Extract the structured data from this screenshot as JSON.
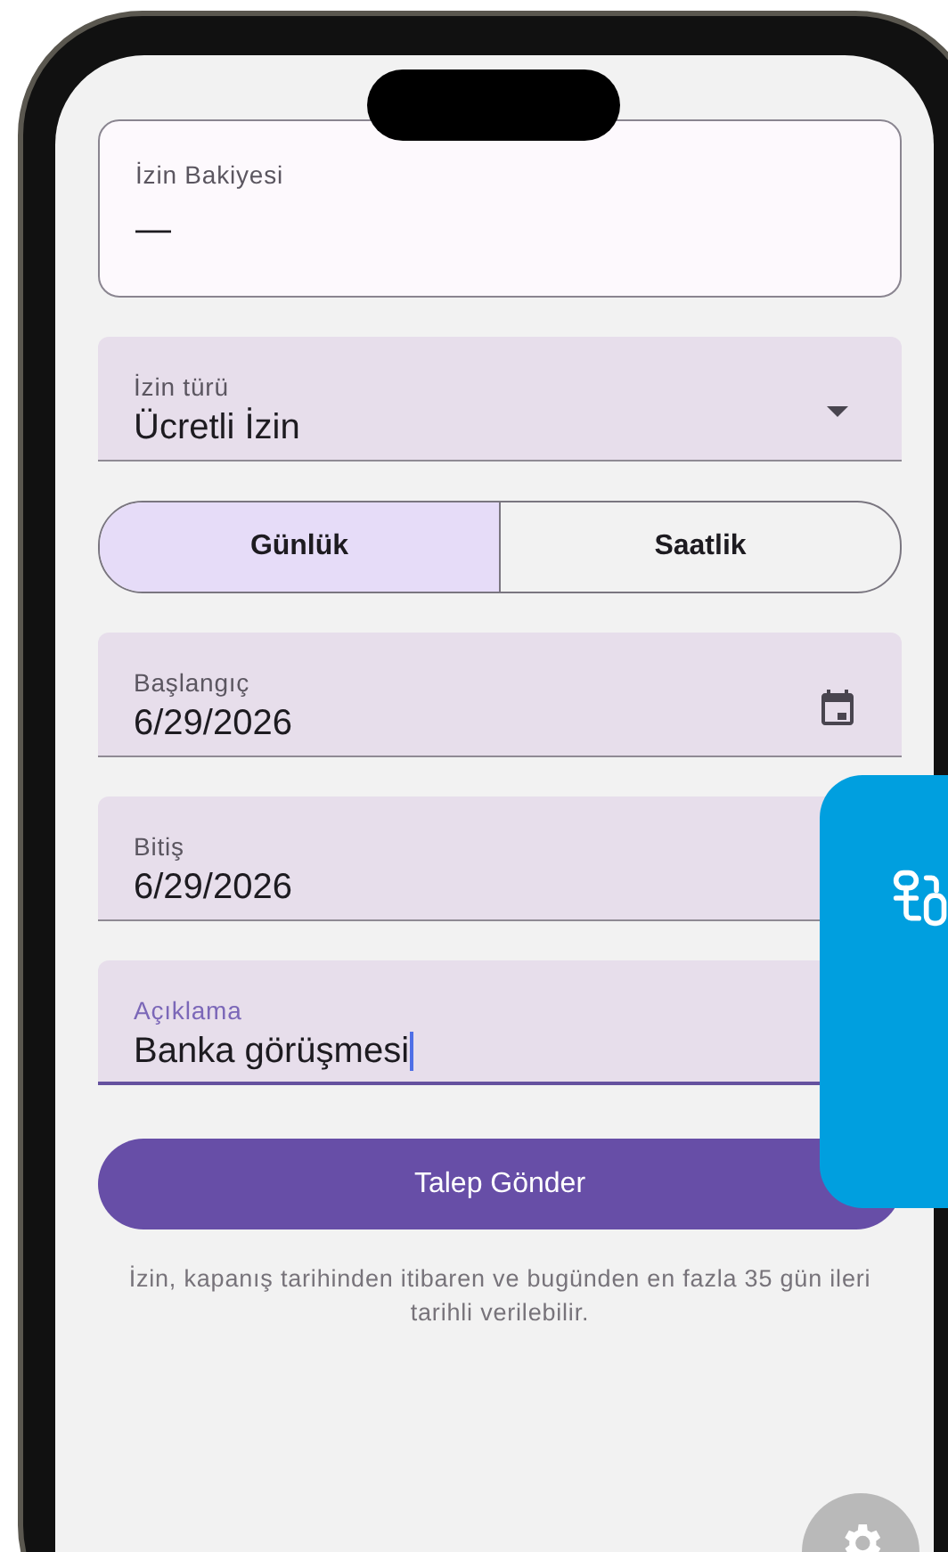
{
  "balance": {
    "label": "İzin Bakiyesi",
    "value": "—"
  },
  "leave_type": {
    "label": "İzin türü",
    "value": "Ücretli İzin"
  },
  "segments": [
    {
      "label": "Günlük",
      "selected": true
    },
    {
      "label": "Saatlik",
      "selected": false
    }
  ],
  "fields": [
    {
      "kind": "date",
      "label": "Başlangıç",
      "value": "6/29/2026",
      "focused": false
    },
    {
      "kind": "date",
      "label": "Bitiş",
      "value": "6/29/2026",
      "focused": false
    },
    {
      "kind": "text",
      "label": "Açıklama",
      "value": "Banka görüşmesi",
      "focused": true
    }
  ],
  "submit_button": "Talep Gönder",
  "note": "İzin, kapanış tarihinden itibaren ve bugünden en fazla 35 gün ileri tarihli verilebilir."
}
